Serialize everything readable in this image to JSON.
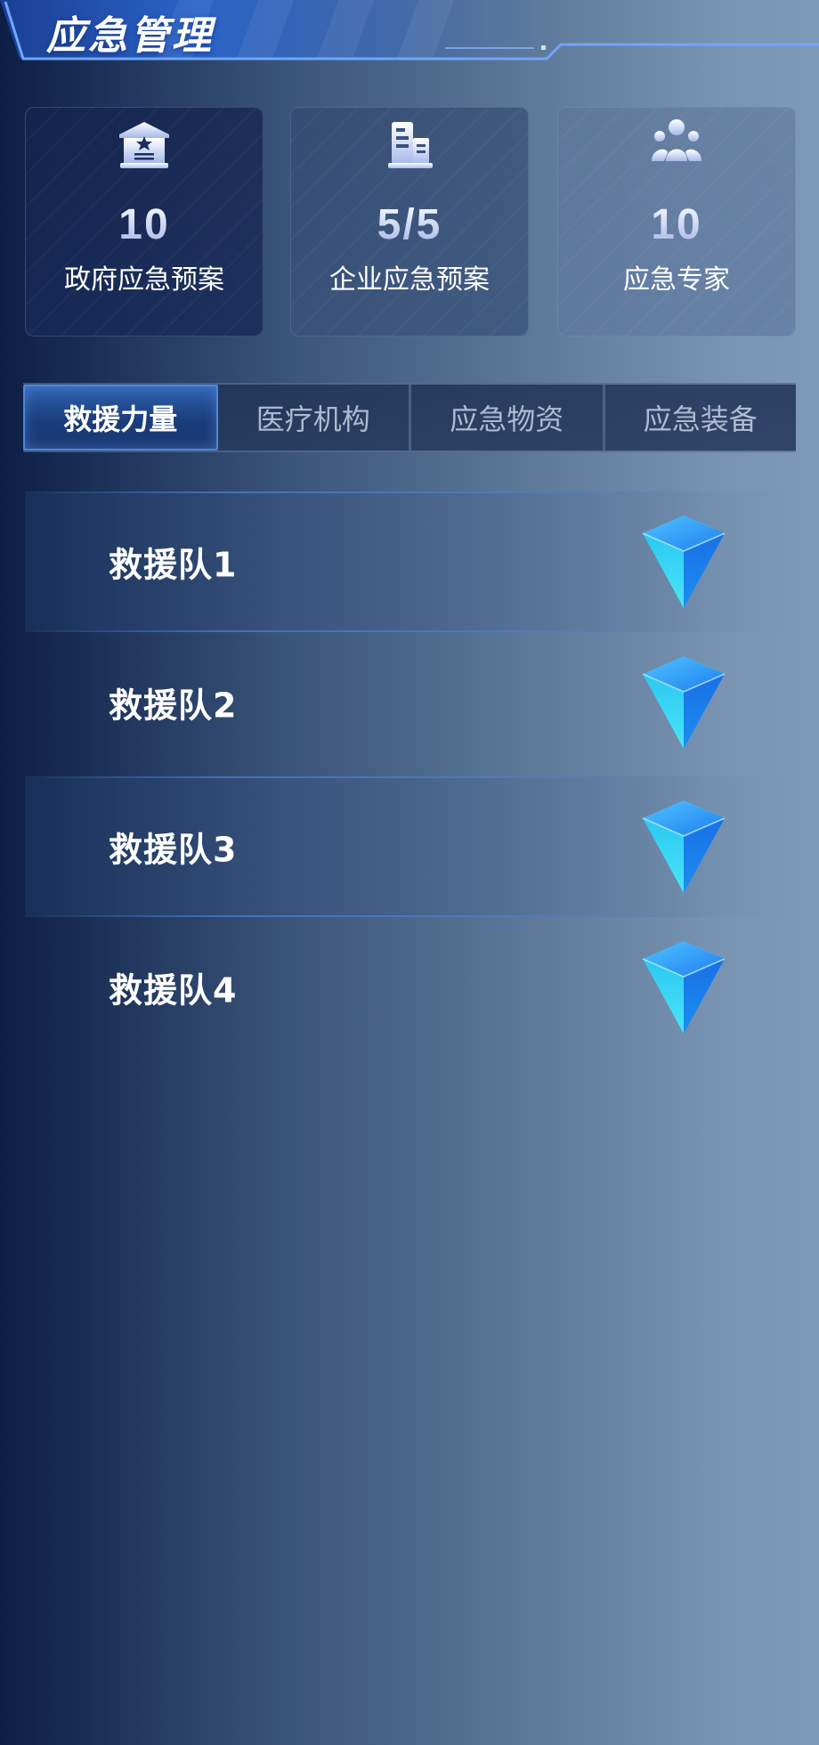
{
  "header": {
    "title": "应急管理"
  },
  "stats": [
    {
      "value": "10",
      "label": "政府应急预案",
      "icon": "government-building-icon"
    },
    {
      "value": "5/5",
      "label": "企业应急预案",
      "icon": "enterprise-building-icon"
    },
    {
      "value": "10",
      "label": "应急专家",
      "icon": "experts-group-icon"
    }
  ],
  "tabs": [
    {
      "label": "救援力量",
      "active": true
    },
    {
      "label": "医疗机构",
      "active": false
    },
    {
      "label": "应急物资",
      "active": false
    },
    {
      "label": "应急装备",
      "active": false
    }
  ],
  "rescue_teams": [
    {
      "name": "救援队1",
      "icon": "blue-gem-icon"
    },
    {
      "name": "救援队2",
      "icon": "blue-gem-icon"
    },
    {
      "name": "救援队3",
      "icon": "blue-gem-icon"
    },
    {
      "name": "救援队4",
      "icon": "blue-gem-icon"
    }
  ],
  "colors": {
    "accent": "#2e63b0",
    "gem_light": "#3fe0f5",
    "gem_dark": "#1466e0"
  }
}
